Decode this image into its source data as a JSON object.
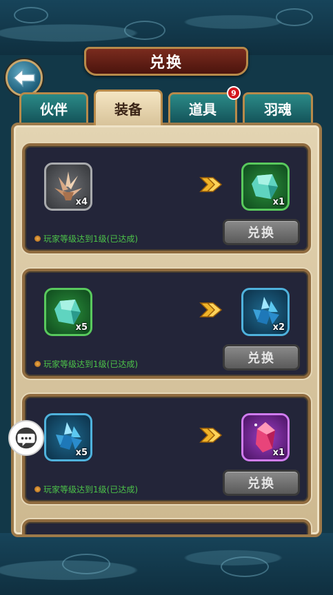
{
  "header": {
    "title": "兑换"
  },
  "tabs": [
    {
      "label": "伙伴",
      "active": false
    },
    {
      "label": "装备",
      "active": true
    },
    {
      "label": "道具",
      "active": false,
      "badge": "9"
    },
    {
      "label": "羽魂",
      "active": false
    }
  ],
  "exchanges": [
    {
      "input": {
        "icon": "rock-crystal-cluster-icon",
        "quantity": "x4",
        "rarity": "gray"
      },
      "output": {
        "icon": "green-crystal-icon",
        "quantity": "x1",
        "rarity": "green"
      },
      "condition": "玩家等级达到1级(已达成)",
      "button_label": "兑换"
    },
    {
      "input": {
        "icon": "green-crystal-icon",
        "quantity": "x5",
        "rarity": "green"
      },
      "output": {
        "icon": "blue-crystal-cluster-icon",
        "quantity": "x2",
        "rarity": "blue"
      },
      "condition": "玩家等级达到1级(已达成)",
      "button_label": "兑换"
    },
    {
      "input": {
        "icon": "blue-crystal-cluster-icon",
        "quantity": "x5",
        "rarity": "blue"
      },
      "output": {
        "icon": "pink-gem-icon",
        "quantity": "x1",
        "rarity": "purple"
      },
      "condition": "玩家等级达到1级(已达成)",
      "button_label": "兑换"
    }
  ],
  "colors": {
    "condition_text": "#4cc349",
    "tab_active": "#e9dab6",
    "tab_inactive": "#1f6f71",
    "title_bar": "#6a2418"
  }
}
